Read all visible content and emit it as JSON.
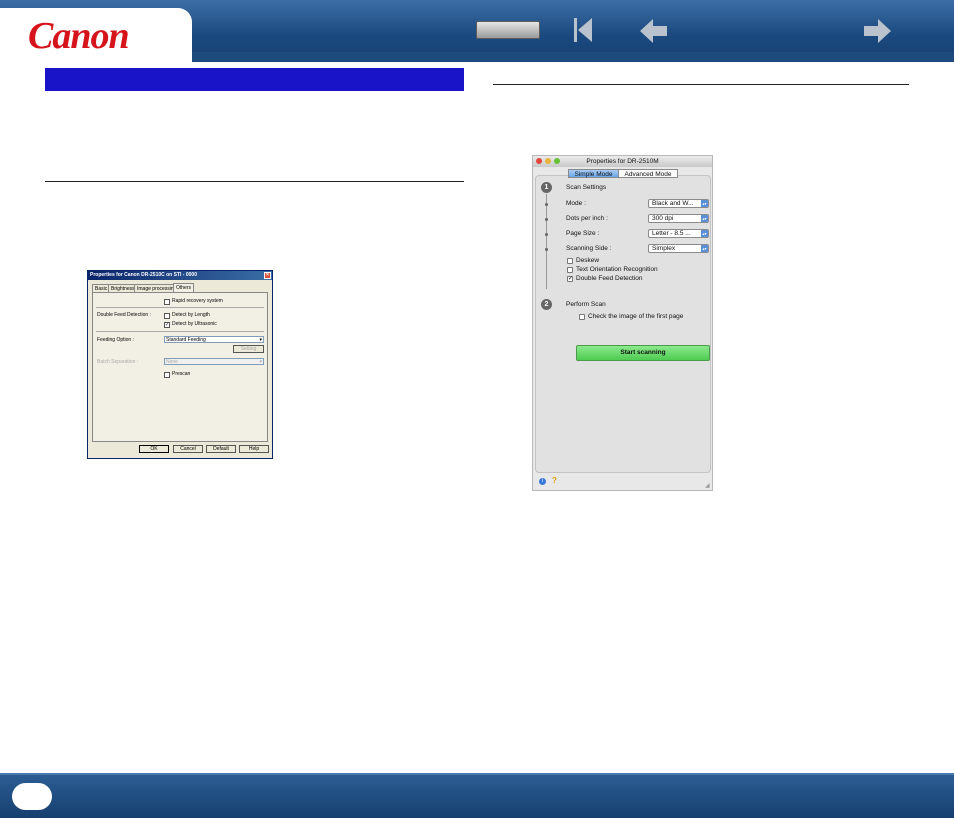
{
  "header": {
    "logo_text": "Canon",
    "nav_button_label": "",
    "icons": [
      "first-page-icon",
      "back-arrow-icon",
      "forward-arrow-icon"
    ]
  },
  "windows_dialog": {
    "title": "Properties for Canon DR-2510C on STI - 0000",
    "tabs": [
      "Basic",
      "Brightness",
      "Image processing",
      "Others"
    ],
    "rapid_recovery": "Rapid recovery system",
    "double_feed_label": "Double Feed Detection :",
    "detect_length": "Detect by Length",
    "detect_ultrasonic": "Detect by Ultrasonic",
    "feeding_option_label": "Feeding Option :",
    "feeding_option_value": "Standard Feeding",
    "setting_button": "Setting",
    "batch_separation_label": "Batch Separation :",
    "batch_separation_value": "None",
    "prescan": "Prescan",
    "buttons": {
      "ok": "OK",
      "cancel": "Cancel",
      "default": "Default",
      "help": "Help"
    }
  },
  "mac_dialog": {
    "title": "Properties for DR-2510M",
    "tabs": {
      "simple": "Simple Mode",
      "advanced": "Advanced Mode"
    },
    "step1": "1",
    "step1_label": "Scan Settings",
    "mode_label": "Mode :",
    "mode_value": "Black and W...",
    "dpi_label": "Dots per inch :",
    "dpi_value": "300 dpi",
    "page_size_label": "Page Size :",
    "page_size_value": "Letter - 8.5 ...",
    "side_label": "Scanning Side :",
    "side_value": "Simplex",
    "deskew": "Deskew",
    "text_orientation": "Text Orientation Recognition",
    "double_feed": "Double Feed Detection",
    "step2": "2",
    "step2_label": "Perform Scan",
    "check_first_page": "Check the image of the first page",
    "start_button": "Start scanning"
  },
  "footer": {
    "page_number": ""
  }
}
